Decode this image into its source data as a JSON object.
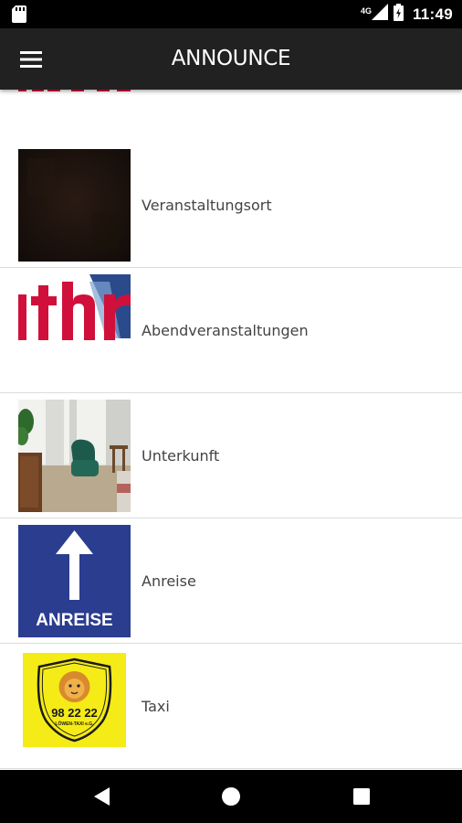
{
  "status_bar": {
    "network": "4G",
    "time": "11:49",
    "icons": [
      "sd-card-icon",
      "signal-icon",
      "battery-charging-icon"
    ]
  },
  "app_bar": {
    "title": "ANNOUNCE",
    "menu_icon": "hamburger-menu-icon"
  },
  "list": {
    "items": [
      {
        "label": "Veranstaltungsort",
        "thumbnail": "dark-venue-image"
      },
      {
        "label": "Abendveranstaltungen",
        "thumbnail": "ith-logo-image"
      },
      {
        "label": "Unterkunft",
        "thumbnail": "hotel-room-image"
      },
      {
        "label": "Anreise",
        "thumbnail": "arrow-sign-image",
        "thumbnail_text": "ANREISE"
      },
      {
        "label": "Taxi",
        "thumbnail": "taxi-badge-image",
        "thumbnail_text": "98 22 22",
        "thumbnail_subtext": "LÖWEN-TAXI e.G."
      }
    ]
  },
  "nav_bar": {
    "icons": [
      "back-icon",
      "home-icon",
      "recents-icon"
    ]
  }
}
